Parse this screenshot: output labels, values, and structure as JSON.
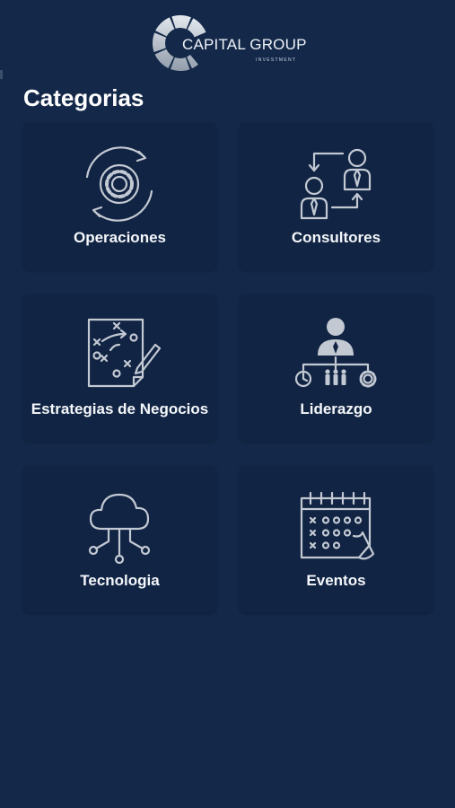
{
  "brand": {
    "name": "CAPITAL GROUP",
    "tagline": "INVESTMENT"
  },
  "page": {
    "title": "Categorias"
  },
  "categories": [
    {
      "label": "Operaciones",
      "icon": "gear-cycle-icon"
    },
    {
      "label": "Consultores",
      "icon": "consultants-exchange-icon"
    },
    {
      "label": "Estrategias de Negocios",
      "icon": "strategy-board-icon"
    },
    {
      "label": "Liderazgo",
      "icon": "leadership-org-icon"
    },
    {
      "label": "Tecnologia",
      "icon": "cloud-network-icon"
    },
    {
      "label": "Eventos",
      "icon": "calendar-icon"
    }
  ],
  "colors": {
    "background": "#14294a",
    "card": "#112443",
    "icon_stroke": "#c3c9d3",
    "text": "#ffffff"
  }
}
